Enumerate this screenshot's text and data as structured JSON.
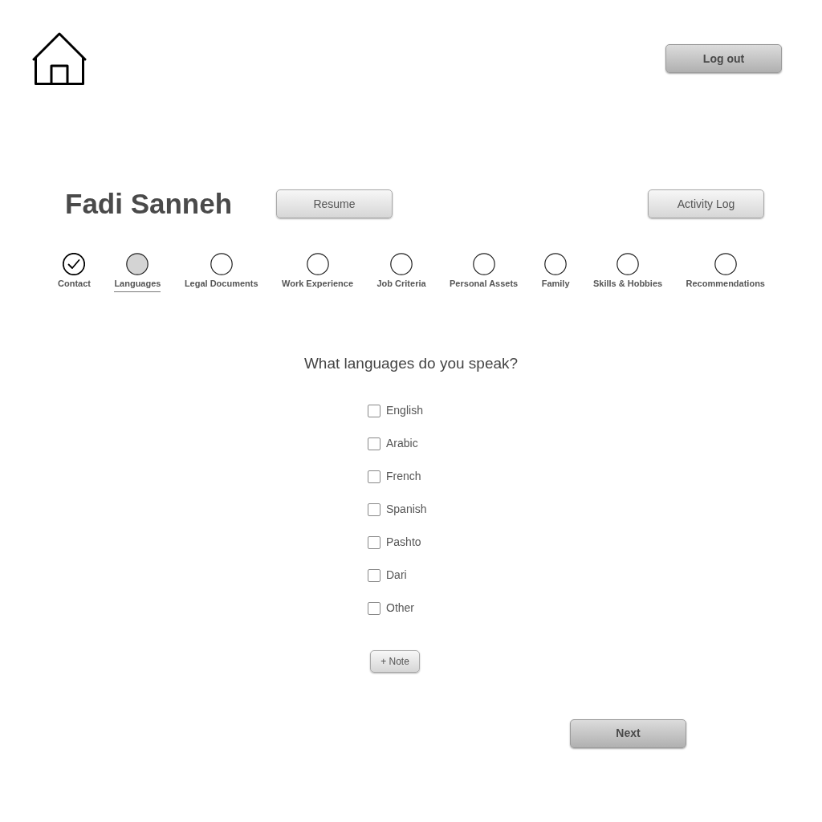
{
  "header": {
    "logout_button": "Log out"
  },
  "profile": {
    "name": "Fadi Sanneh",
    "buttons": [
      "Resume",
      "Activity Log"
    ]
  },
  "steps": [
    {
      "label": "Contact",
      "completed": true,
      "selected": false
    },
    {
      "label": "Languages",
      "completed": false,
      "selected": true
    },
    {
      "label": "Legal Documents",
      "completed": false,
      "selected": false
    },
    {
      "label": "Work Experience",
      "completed": false,
      "selected": false
    },
    {
      "label": "Job Criteria",
      "completed": false,
      "selected": false
    },
    {
      "label": "Personal Assets",
      "completed": false,
      "selected": false
    },
    {
      "label": "Family",
      "completed": false,
      "selected": false
    },
    {
      "label": "Skills & Hobbies",
      "completed": false,
      "selected": false
    },
    {
      "label": "Recommendations",
      "completed": false,
      "selected": false
    }
  ],
  "question": "What languages do you speak?",
  "languages": [
    {
      "label": "English",
      "checked": false
    },
    {
      "label": "Arabic",
      "checked": false
    },
    {
      "label": "French",
      "checked": false
    },
    {
      "label": "Spanish",
      "checked": false
    },
    {
      "label": "Pashto",
      "checked": false
    },
    {
      "label": "Dari",
      "checked": false
    },
    {
      "label": "Other",
      "checked": false
    }
  ],
  "note_button": "+ Note",
  "next_button": "Next"
}
